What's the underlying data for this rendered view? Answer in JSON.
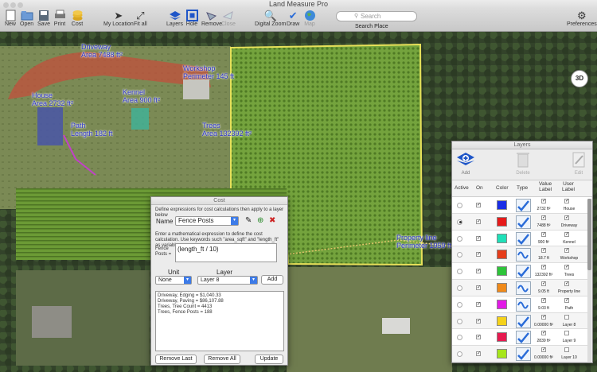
{
  "window": {
    "title": "Land Measure Pro"
  },
  "toolbar": {
    "new": "New",
    "open": "Open",
    "save": "Save",
    "print": "Print",
    "cost": "Cost",
    "my_location": "My Location",
    "fit_all": "Fit all",
    "layers": "Layers",
    "hole": "Hole",
    "remove": "Remove",
    "close": "Close",
    "digital_zoom": "Digital Zoom",
    "draw": "Draw",
    "map": "Map",
    "search_placeholder": "Search",
    "search_place": "Search Place",
    "preferences": "Preferences"
  },
  "map": {
    "btn_3d": "3D",
    "labels": [
      {
        "name": "Driveway",
        "value": "Area 7488 ft²"
      },
      {
        "name": "Workshop",
        "value": "Perimeter 145 ft"
      },
      {
        "name": "House",
        "value": "Area 2732 ft²"
      },
      {
        "name": "Kennel",
        "value": "Area 900 ft²"
      },
      {
        "name": "Path",
        "value": "Length 182 ft"
      },
      {
        "name": "Trees",
        "value": "Area 132392 ft²"
      },
      {
        "name": "Property line",
        "value": "Perimeter 1959 ft"
      }
    ]
  },
  "cost": {
    "title": "Cost",
    "intro": "Define expressions for cost calculations then apply to a layer below",
    "name_label": "Name",
    "name_value": "Fence Posts",
    "instructions": "Enter a mathematical expression to define the cost calculation. Use keywords such \"area_sqft\" and \"length_ft\" as variables.",
    "expr_label_1": "Fence",
    "expr_label_2": "Posts =",
    "expression": "(length_ft / 10)",
    "unit_label": "Unit",
    "layer_label": "Layer",
    "unit_value": "None",
    "layer_value": "Layer 8",
    "add": "Add",
    "results": [
      "Driveway, Edging = $1,040.33",
      "Driveway, Paving = $86,107.88",
      "Trees, Tree Count = 4413",
      "Trees, Fence Posts = 188"
    ],
    "remove_last": "Remove Last",
    "remove_all": "Remove All",
    "update": "Update"
  },
  "layers": {
    "title": "Layers",
    "add": "Add",
    "delete": "Delete",
    "edit": "Edit",
    "headers": {
      "active": "Active",
      "on": "On",
      "color": "Color",
      "type": "Type",
      "value_label_1": "Value",
      "value_label_2": "Label",
      "user_label_1": "User",
      "user_label_2": "Label"
    },
    "rows": [
      {
        "active": false,
        "on": true,
        "color": "#1a2ee6",
        "type": "check",
        "value": "2732 ft²",
        "value_on": true,
        "user": "House",
        "user_on": true
      },
      {
        "active": true,
        "on": true,
        "color": "#e61a1a",
        "type": "check",
        "value": "7488 ft²",
        "value_on": true,
        "user": "Driveway",
        "user_on": true
      },
      {
        "active": false,
        "on": true,
        "color": "#1fe0b8",
        "type": "check",
        "value": "900 ft²",
        "value_on": true,
        "user": "Kennel",
        "user_on": true
      },
      {
        "active": false,
        "on": true,
        "color": "#e63d1a",
        "type": "wave",
        "value": "18.7 ft",
        "value_on": true,
        "user": "Workshop",
        "user_on": true
      },
      {
        "active": false,
        "on": true,
        "color": "#2ec43a",
        "type": "check",
        "value": "132392 ft²",
        "value_on": true,
        "user": "Trees",
        "user_on": true
      },
      {
        "active": false,
        "on": true,
        "color": "#f08a1a",
        "type": "wave",
        "value": "9.05 ft",
        "value_on": true,
        "user": "Property line",
        "user_on": true
      },
      {
        "active": false,
        "on": true,
        "color": "#e21ae6",
        "type": "wave",
        "value": "9.03 ft",
        "value_on": true,
        "user": "Path",
        "user_on": true
      },
      {
        "active": false,
        "on": true,
        "color": "#f5d21a",
        "type": "check",
        "value": "0.00000 ft²",
        "value_on": true,
        "user": "Layer 8",
        "user_on": false
      },
      {
        "active": false,
        "on": true,
        "color": "#e61a50",
        "type": "check",
        "value": "2839 ft²",
        "value_on": true,
        "user": "Layer 9",
        "user_on": false
      },
      {
        "active": false,
        "on": true,
        "color": "#a6e61a",
        "type": "check",
        "value": "0.00000 ft²",
        "value_on": true,
        "user": "Layer 10",
        "user_on": false
      }
    ]
  }
}
